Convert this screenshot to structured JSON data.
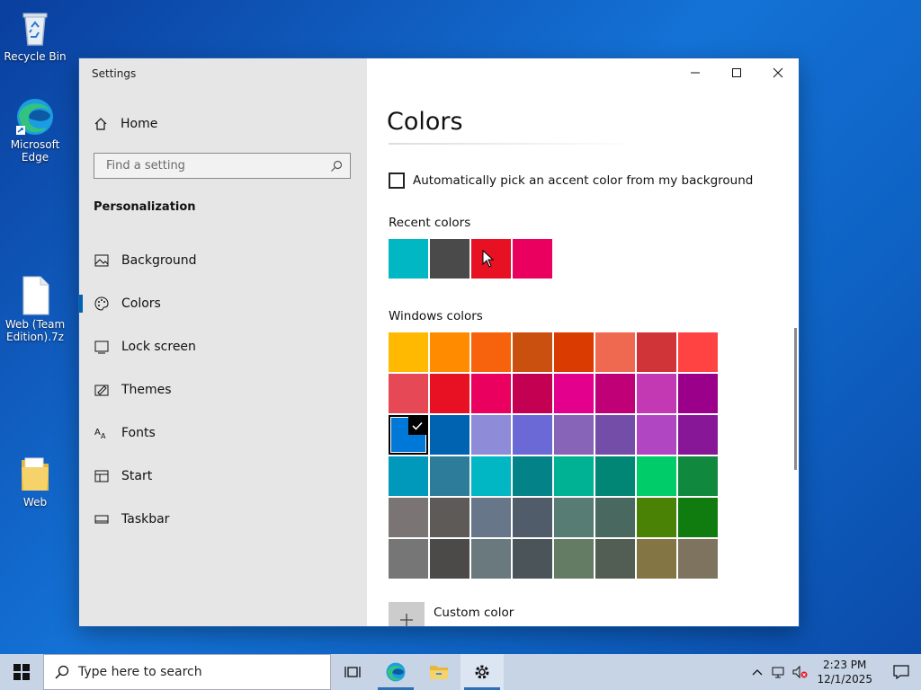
{
  "desktop": {
    "icons": [
      {
        "label": "Recycle Bin"
      },
      {
        "label": "Microsoft Edge"
      },
      {
        "label": "Web (Team Edition).7z"
      },
      {
        "label": "Web"
      }
    ]
  },
  "window": {
    "title": "Settings",
    "sidebar": {
      "home_label": "Home",
      "search_placeholder": "Find a setting",
      "section_label": "Personalization",
      "items": [
        {
          "label": "Background",
          "icon": "image-icon"
        },
        {
          "label": "Colors",
          "icon": "palette-icon",
          "active": true
        },
        {
          "label": "Lock screen",
          "icon": "lock-screen-icon"
        },
        {
          "label": "Themes",
          "icon": "themes-icon"
        },
        {
          "label": "Fonts",
          "icon": "fonts-icon"
        },
        {
          "label": "Start",
          "icon": "start-icon"
        },
        {
          "label": "Taskbar",
          "icon": "taskbar-icon"
        }
      ]
    },
    "content": {
      "page_title": "Colors",
      "auto_accent_label": "Automatically pick an accent color from my background",
      "auto_accent_checked": false,
      "recent_heading": "Recent colors",
      "recent_colors": [
        "#00b7c3",
        "#4a4a4a",
        "#e81123",
        "#ea005e"
      ],
      "windows_heading": "Windows colors",
      "windows_colors": [
        "#ffb900",
        "#ff8c00",
        "#f7630c",
        "#ca5010",
        "#da3b01",
        "#ef6950",
        "#d13438",
        "#ff4343",
        "#e74856",
        "#e81123",
        "#ea005e",
        "#c30052",
        "#e3008c",
        "#bf0077",
        "#c239b3",
        "#9a0089",
        "#0078d7",
        "#0063b1",
        "#8e8cd8",
        "#6b69d6",
        "#8764b8",
        "#744da9",
        "#b146c2",
        "#881798",
        "#0099bc",
        "#2d7d9a",
        "#00b7c3",
        "#038387",
        "#00b294",
        "#018574",
        "#00cc6a",
        "#10893e",
        "#7a7574",
        "#5d5a58",
        "#68768a",
        "#515c6b",
        "#567c73",
        "#486860",
        "#498205",
        "#107c10",
        "#767676",
        "#4c4a48",
        "#69797e",
        "#4a5459",
        "#647c64",
        "#525e54",
        "#847545",
        "#7e735f"
      ],
      "selected_index": 16,
      "custom_color_label": "Custom color"
    }
  },
  "taskbar": {
    "search_placeholder": "Type here to search",
    "apps": [
      {
        "name": "task-view",
        "icon": "task-view-icon"
      },
      {
        "name": "edge",
        "icon": "edge-icon"
      },
      {
        "name": "file-explorer",
        "icon": "folder-icon"
      },
      {
        "name": "settings",
        "icon": "gear-icon",
        "active": true
      }
    ],
    "time": "2:23 PM",
    "date": "12/1/2025"
  }
}
